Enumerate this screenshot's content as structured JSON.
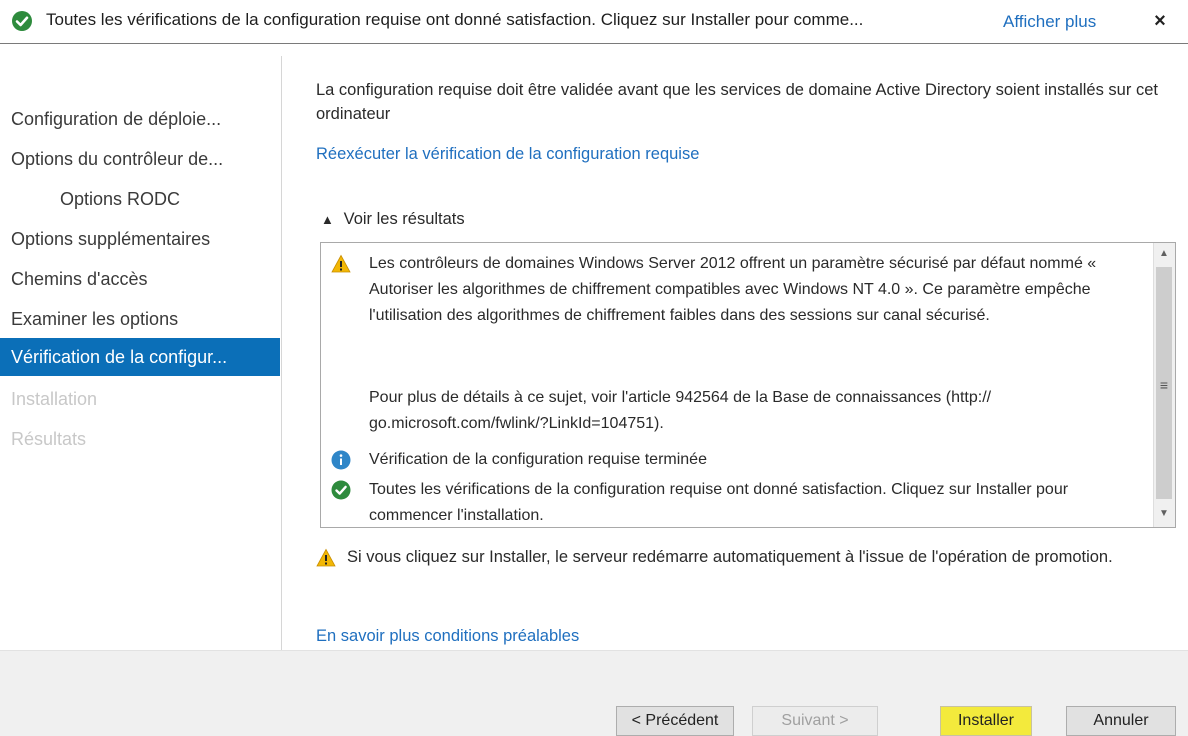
{
  "topbar": {
    "message": "Toutes les vérifications de la configuration requise ont donné satisfaction. Cliquez sur Installer pour comme...",
    "more_link": "Afficher plus",
    "close_glyph": "×"
  },
  "nav": {
    "items": [
      {
        "label": "Configuration de déploie...",
        "state": "normal"
      },
      {
        "label": "Options du contrôleur de...",
        "state": "normal"
      },
      {
        "label": "Options RODC",
        "state": "sub"
      },
      {
        "label": "Options supplémentaires",
        "state": "normal"
      },
      {
        "label": "Chemins d'accès",
        "state": "normal"
      },
      {
        "label": "Examiner les options",
        "state": "normal"
      },
      {
        "label": "Vérification de la configur...",
        "state": "active"
      },
      {
        "label": "Installation",
        "state": "disabled"
      },
      {
        "label": "Résultats",
        "state": "disabled"
      }
    ]
  },
  "main": {
    "intro": "La configuration requise doit être validée avant que les services de domaine Active Directory soient installés sur cet ordinateur",
    "rerun_link": "Réexécuter la vérification de la configuration requise",
    "results_toggle": "Voir les résultats",
    "results": {
      "warning_text": "Les contrôleurs de domaines Windows Server 2012 offrent un paramètre sécurisé par défaut nommé « Autoriser les algorithmes de chiffrement compatibles avec Windows NT 4.0 ». Ce paramètre empêche l'utilisation des algorithmes de chiffrement faibles dans des sessions sur canal sécurisé.",
      "warning_details": "Pour plus de détails à ce sujet, voir l'article 942564 de la Base de connaissances (http:// go.microsoft.com/fwlink/?LinkId=104751).",
      "info_text": "Vérification de la configuration requise terminée",
      "success_text": "Toutes les vérifications de la configuration requise ont donné satisfaction. Cliquez sur Installer pour commencer l'installation."
    },
    "restart_warning": "Si vous cliquez sur Installer, le serveur redémarre automatiquement à l'issue de l'opération de promotion.",
    "learn_more_link": "En savoir plus conditions préalables"
  },
  "footer": {
    "prev_label": "< Précédent",
    "next_label": "Suivant >",
    "install_label": "Installer",
    "cancel_label": "Annuler"
  },
  "colors": {
    "accent": "#0b6fb8",
    "link": "#1f6fbf",
    "success": "#2e8b3d",
    "warning": "#f2b705",
    "info": "#2f86c8",
    "highlight": "#f3ea3c"
  }
}
